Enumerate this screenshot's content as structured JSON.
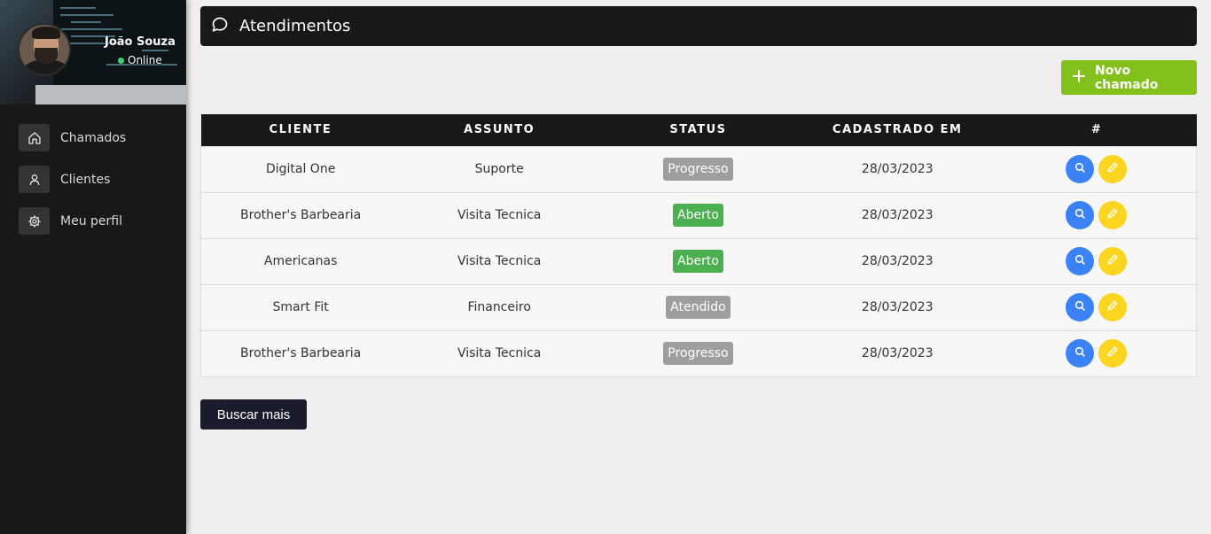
{
  "user": {
    "name": "João Souza",
    "status": "Online"
  },
  "sidebar": {
    "items": [
      {
        "label": "Chamados",
        "icon": "home-icon"
      },
      {
        "label": "Clientes",
        "icon": "user-icon"
      },
      {
        "label": "Meu perfil",
        "icon": "gear-icon"
      }
    ]
  },
  "header": {
    "title": "Atendimentos",
    "icon": "chat-bubble-icon"
  },
  "new_button": {
    "label": "Novo chamado",
    "icon": "plus-icon"
  },
  "table": {
    "headers": [
      "CLIENTE",
      "ASSUNTO",
      "STATUS",
      "CADASTRADO EM",
      "#"
    ],
    "rows": [
      {
        "client": "Digital One",
        "subject": "Suporte",
        "status": "Progresso",
        "date": "28/03/2023"
      },
      {
        "client": "Brother's Barbearia",
        "subject": "Visita Tecnica",
        "status": "Aberto",
        "date": "28/03/2023"
      },
      {
        "client": "Americanas",
        "subject": "Visita Tecnica",
        "status": "Aberto",
        "date": "28/03/2023"
      },
      {
        "client": "Smart Fit",
        "subject": "Financeiro",
        "status": "Atendido",
        "date": "28/03/2023"
      },
      {
        "client": "Brother's Barbearia",
        "subject": "Visita Tecnica",
        "status": "Progresso",
        "date": "28/03/2023"
      }
    ]
  },
  "load_more": {
    "label": "Buscar mais"
  },
  "colors": {
    "sidebar_bg": "#181818",
    "new_button": "#83c01b",
    "status_open": "#4caf50",
    "status_progress": "#9e9e9e",
    "view_button": "#3b82f6",
    "edit_button": "#fcd520",
    "load_more_bg": "#1b1b2e"
  }
}
